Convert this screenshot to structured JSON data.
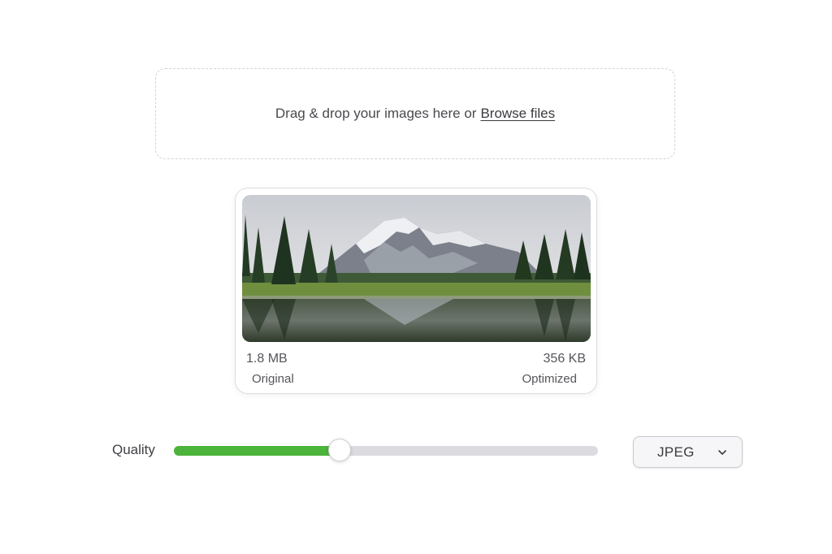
{
  "upload": {
    "prompt": "Drag & drop your images here or",
    "browse_label": "Browse files"
  },
  "preview": {
    "image_icon": "mountain-lake-photo",
    "original_size": "1.8 MB",
    "optimized_size": "356 KB",
    "original_label": "Original",
    "optimized_label": "Optimized"
  },
  "controls": {
    "quality_label": "Quality",
    "quality_value_fraction": 0.39,
    "format": {
      "selected": "JPEG",
      "icon": "chevron-down-icon"
    }
  },
  "colors": {
    "accent": "#4cb43a",
    "track": "#dcdce0"
  }
}
